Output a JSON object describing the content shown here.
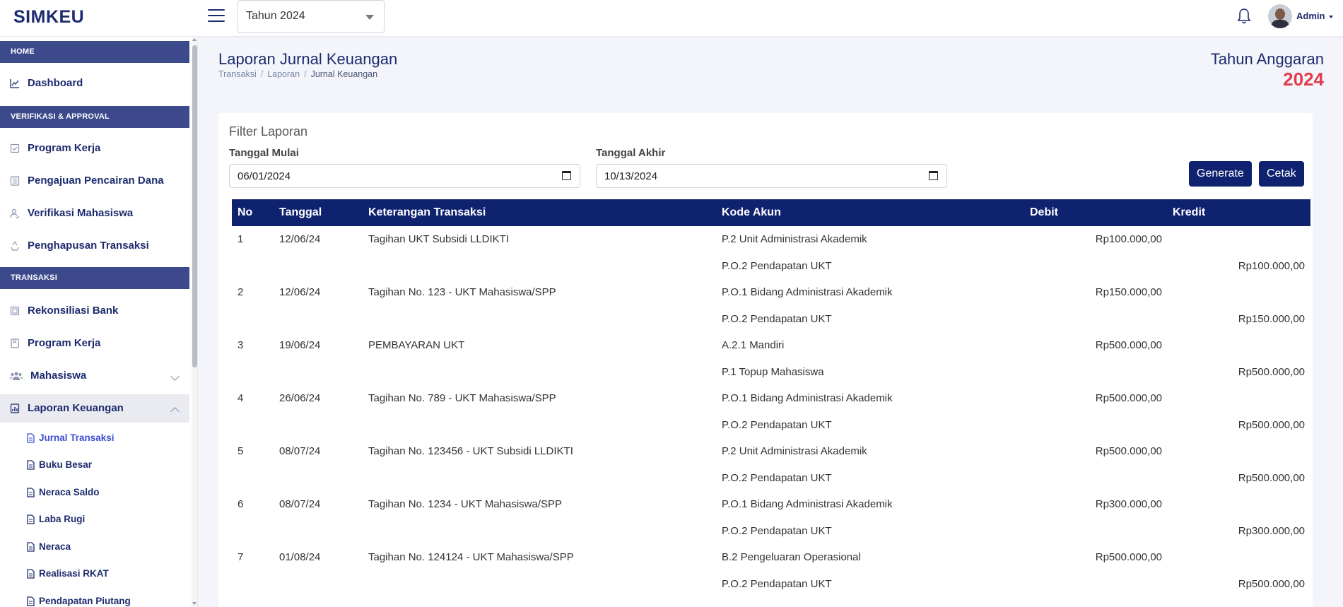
{
  "topbar": {
    "brand": "SIMKEU",
    "year_select": "Tahun 2024",
    "user": "Admin"
  },
  "sidebar": {
    "sections": {
      "home": "HOME",
      "verifikasi": "VERIFIKASI & APPROVAL",
      "transaksi": "TRANSAKSI"
    },
    "items": {
      "dashboard": "Dashboard",
      "program_kerja_1": "Program Kerja",
      "pengajuan": "Pengajuan Pencairan Dana",
      "verifikasi_mhs": "Verifikasi Mahasiswa",
      "penghapusan": "Penghapusan Transaksi",
      "rekonsiliasi": "Rekonsiliasi Bank",
      "program_kerja_2": "Program Kerja",
      "mahasiswa": "Mahasiswa",
      "laporan": "Laporan Keuangan"
    },
    "sub_items": [
      "Jurnal Transaksi",
      "Buku Besar",
      "Neraca Saldo",
      "Laba Rugi",
      "Neraca",
      "Realisasi RKAT",
      "Pendapatan Piutang"
    ]
  },
  "header": {
    "title": "Laporan Jurnal Keuangan",
    "breadcrumb": [
      "Transaksi",
      "Laporan",
      "Jurnal Keuangan"
    ],
    "tahun_anggaran_label": "Tahun Anggaran",
    "tahun_anggaran_value": "2024"
  },
  "filter": {
    "title": "Filter Laporan",
    "start_label": "Tanggal Mulai",
    "start_value": "06/01/2024",
    "end_label": "Tanggal Akhir",
    "end_value": "10/13/2024",
    "generate": "Generate",
    "cetak": "Cetak"
  },
  "table": {
    "headers": [
      "No",
      "Tanggal",
      "Keterangan Transaksi",
      "Kode Akun",
      "Debit",
      "Kredit"
    ],
    "rows": [
      {
        "no": "1",
        "tanggal": "12/06/24",
        "ket": "Tagihan UKT Subsidi LLDIKTI",
        "akun": "P.2 Unit Administrasi Akademik",
        "debit": "Rp100.000,00",
        "kredit": ""
      },
      {
        "no": "",
        "tanggal": "",
        "ket": "",
        "akun": "P.O.2 Pendapatan UKT",
        "debit": "",
        "kredit": "Rp100.000,00"
      },
      {
        "no": "2",
        "tanggal": "12/06/24",
        "ket": "Tagihan No. 123 - UKT Mahasiswa/SPP",
        "akun": "P.O.1 Bidang Administrasi Akademik",
        "debit": "Rp150.000,00",
        "kredit": ""
      },
      {
        "no": "",
        "tanggal": "",
        "ket": "",
        "akun": "P.O.2 Pendapatan UKT",
        "debit": "",
        "kredit": "Rp150.000,00"
      },
      {
        "no": "3",
        "tanggal": "19/06/24",
        "ket": "PEMBAYARAN UKT",
        "akun": "A.2.1 Mandiri",
        "debit": "Rp500.000,00",
        "kredit": ""
      },
      {
        "no": "",
        "tanggal": "",
        "ket": "",
        "akun": "P.1 Topup Mahasiswa",
        "debit": "",
        "kredit": "Rp500.000,00"
      },
      {
        "no": "4",
        "tanggal": "26/06/24",
        "ket": "Tagihan No. 789 - UKT Mahasiswa/SPP",
        "akun": "P.O.1 Bidang Administrasi Akademik",
        "debit": "Rp500.000,00",
        "kredit": ""
      },
      {
        "no": "",
        "tanggal": "",
        "ket": "",
        "akun": "P.O.2 Pendapatan UKT",
        "debit": "",
        "kredit": "Rp500.000,00"
      },
      {
        "no": "5",
        "tanggal": "08/07/24",
        "ket": "Tagihan No. 123456 - UKT Subsidi LLDIKTI",
        "akun": "P.2 Unit Administrasi Akademik",
        "debit": "Rp500.000,00",
        "kredit": ""
      },
      {
        "no": "",
        "tanggal": "",
        "ket": "",
        "akun": "P.O.2 Pendapatan UKT",
        "debit": "",
        "kredit": "Rp500.000,00"
      },
      {
        "no": "6",
        "tanggal": "08/07/24",
        "ket": "Tagihan No. 1234 - UKT Mahasiswa/SPP",
        "akun": "P.O.1 Bidang Administrasi Akademik",
        "debit": "Rp300.000,00",
        "kredit": ""
      },
      {
        "no": "",
        "tanggal": "",
        "ket": "",
        "akun": "P.O.2 Pendapatan UKT",
        "debit": "",
        "kredit": "Rp300.000,00"
      },
      {
        "no": "7",
        "tanggal": "01/08/24",
        "ket": "Tagihan No. 124124 - UKT Mahasiswa/SPP",
        "akun": "B.2 Pengeluaran Operasional",
        "debit": "Rp500.000,00",
        "kredit": ""
      },
      {
        "no": "",
        "tanggal": "",
        "ket": "",
        "akun": "P.O.2 Pendapatan UKT",
        "debit": "",
        "kredit": "Rp500.000,00"
      }
    ]
  },
  "colors": {
    "navy": "#0e2270",
    "section": "#3c4a8c",
    "accent_red": "#e03e4e",
    "active_link": "#3c4fd4"
  }
}
